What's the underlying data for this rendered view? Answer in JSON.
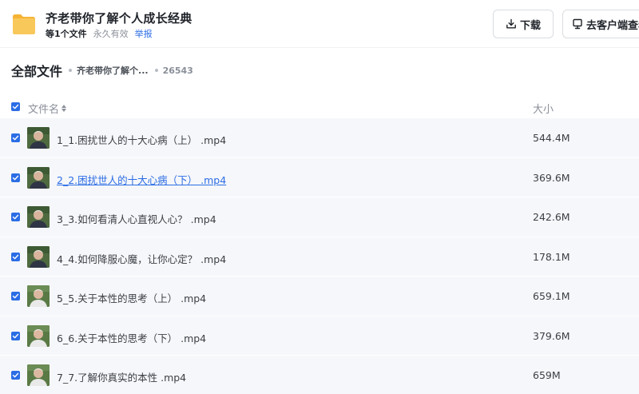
{
  "header": {
    "title": "齐老带你了解个人成长经典",
    "file_count": "等1个文件",
    "validity": "永久有效",
    "report_label": "举报",
    "download_label": "下载",
    "client_label": "去客户端查看"
  },
  "breadcrumb": {
    "root": "全部文件",
    "folder": "齐老带你了解个...",
    "last": "26543"
  },
  "columns": {
    "name": "文件名",
    "size": "大小"
  },
  "files": [
    {
      "name": "1_1.困扰世人的十大心病（上） .mp4",
      "size": "544.4M"
    },
    {
      "name": "2_2.困扰世人的十大心病（下） .mp4",
      "size": "369.6M"
    },
    {
      "name": "3_3.如何看清人心直视人心？ .mp4",
      "size": "242.6M"
    },
    {
      "name": "4_4.如何降服心魔，让你心定？ .mp4",
      "size": "178.1M"
    },
    {
      "name": "5_5.关于本性的思考（上） .mp4",
      "size": "659.1M"
    },
    {
      "name": "6_6.关于本性的思考（下） .mp4",
      "size": "379.6M"
    },
    {
      "name": "7_7.了解你真实的本性 .mp4",
      "size": "659M"
    }
  ],
  "colors": {
    "accent": "#2b6de5",
    "folder": "#f7c04a",
    "row_bg": "#f6f7fa"
  }
}
